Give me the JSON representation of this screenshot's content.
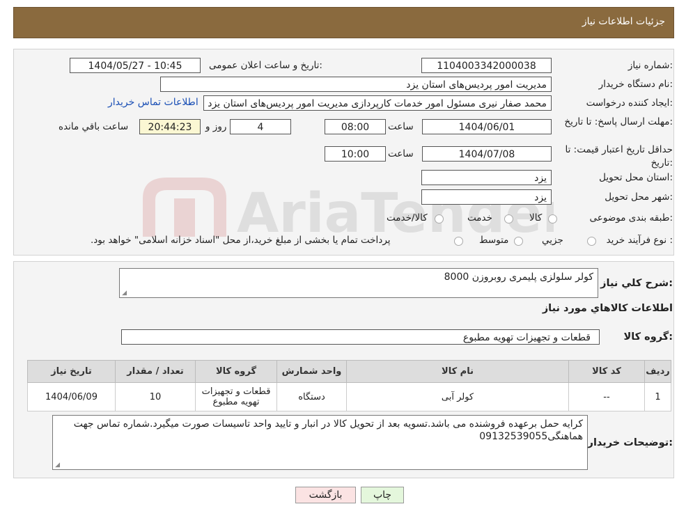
{
  "header": {
    "title": "جزئیات اطلاعات نیاز"
  },
  "watermark": {
    "text": "AriaTender.neT"
  },
  "form": {
    "need_number_label": "شماره نیاز:",
    "need_number": "1104003342000038",
    "announce_label": "تاریخ و ساعت اعلان عمومی:",
    "announce_value": "1404/05/27 - 10:45",
    "buyer_label": "نام دستگاه خریدار:",
    "buyer_value": "مدیریت امور پردیس‌های استان یزد",
    "creator_label": "ایجاد کننده درخواست:",
    "creator_value": "محمد  صفار نیری مسئول امور خدمات کارپردازی مدیریت امور پردیس‌های استان یزد",
    "contact_link": "اطلاعات تماس خریدار",
    "deadline_label": "مهلت ارسال پاسخ: تا تاریخ:",
    "deadline_date": "1404/06/01",
    "time_label": "ساعت",
    "deadline_time": "08:00",
    "days_value": "4",
    "days_label": "روز و",
    "remaining_value": "20:44:23",
    "remaining_label": "ساعت باقي مانده",
    "validity_label": "حداقل تاریخ اعتبار قیمت: تا تاریخ:",
    "validity_date": "1404/07/08",
    "validity_time": "10:00",
    "province_label": "استان محل تحویل:",
    "province_value": "یزد",
    "city_label": "شهر محل تحویل:",
    "city_value": "یزد",
    "category_label": "طبقه بندی موضوعی:",
    "category_options": [
      "کالا",
      "خدمت",
      "کالا/خدمت"
    ],
    "process_label": "نوع فرآیند خرید :",
    "process_options": [
      "جزيي",
      "متوسط"
    ],
    "process_note": "پرداخت تمام یا بخشی از مبلغ خرید،از محل \"اسناد خزانه اسلامی\" خواهد بود."
  },
  "need": {
    "summary_label": "شرح کلي نياز:",
    "summary_value": "کولر سلولزی پلیمری روبروزن 8000",
    "goods_info_title": "اطلاعات كالاهاي مورد نياز",
    "group_label": "گروه کالا:",
    "group_value": "قطعات و تجهیزات تهویه مطبوع"
  },
  "table": {
    "headers": [
      "رديف",
      "کد کالا",
      "نام کالا",
      "واحد شمارش",
      "گروه کالا",
      "تعداد / مقدار",
      "تاریخ نیاز"
    ],
    "rows": [
      [
        "1",
        "--",
        "کولر آبی",
        "دستگاه",
        "قطعات و تجهیزات تهویه مطبوع",
        "10",
        "1404/06/09"
      ]
    ]
  },
  "buyer_notes": {
    "label": "توضیحات خریدار:",
    "value": "کرایه حمل برعهده فروشنده می باشد.تسویه بعد از تحویل کالا در انبار و تایید واحد تاسیسات صورت میگیرد.شماره تماس جهت هماهنگی09132539055"
  },
  "buttons": {
    "print": "چاپ",
    "back": "بازگشت"
  },
  "colors": {
    "header": "#8a6a3e",
    "link": "#1a4fb5",
    "print_btn": "#e4f7dc",
    "back_btn": "#fbe3e3"
  }
}
